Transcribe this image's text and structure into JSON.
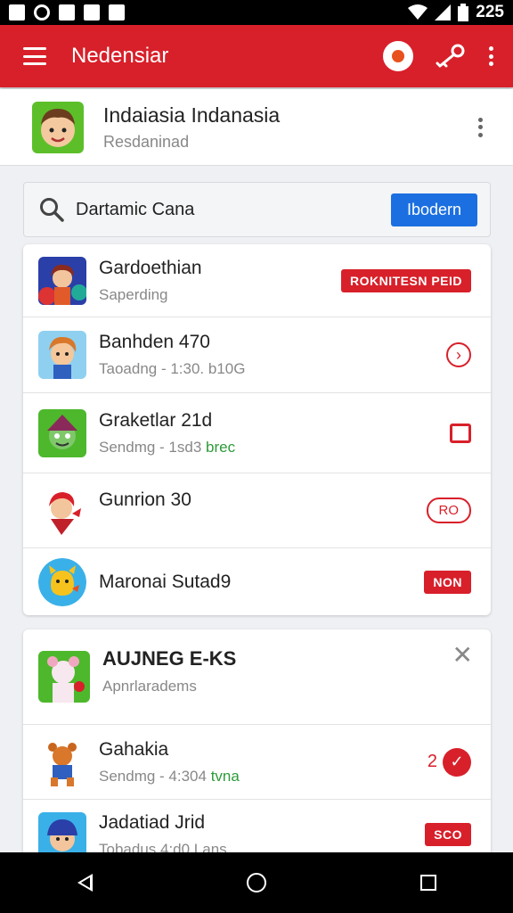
{
  "status_bar": {
    "time": "225"
  },
  "app_bar": {
    "title": "Nedensiar"
  },
  "profile": {
    "name": "Indaiasia Indanasia",
    "subtitle": "Resdaninad"
  },
  "search": {
    "value": "Dartamic Cana",
    "button_label": "Ibodern"
  },
  "list1": [
    {
      "title": "Gardoethian",
      "subtitle": "Saperding",
      "subtitle_extra": "",
      "action": "ROKNITESN PEID"
    },
    {
      "title": "Banhden 470",
      "subtitle": "Taoadng - 1:30. b10G",
      "subtitle_extra": "",
      "action": ""
    },
    {
      "title": "Graketlar 21d",
      "subtitle": "Sendmg - 1sd3",
      "subtitle_extra": "brec",
      "action": ""
    },
    {
      "title": "Gunrion 30",
      "subtitle": "",
      "subtitle_extra": "",
      "action": "RO"
    },
    {
      "title": "Maronai Sutad9",
      "subtitle": "",
      "subtitle_extra": "",
      "action": "NON"
    }
  ],
  "list2": [
    {
      "title": "AUJNEG E-KS",
      "subtitle": "Apnrlaradems",
      "subtitle_extra": "",
      "action": ""
    },
    {
      "title": "Gahakia",
      "subtitle": "Sendmg - 4:304",
      "subtitle_extra": "tvna",
      "action": "2"
    },
    {
      "title": "Jadatiad Jrid",
      "subtitle": "Tobadus 4:d0 Lans",
      "subtitle_extra": "",
      "action": "SCO"
    }
  ],
  "icons": {
    "menu": "hamburger-menu-icon",
    "badge": "notification-badge-icon",
    "key": "key-icon",
    "more": "more-vert-icon",
    "search": "search-icon",
    "close": "close-icon"
  },
  "colors": {
    "primary": "#d8202a",
    "accent": "#1b6fe0",
    "green": "#2e9a3a"
  }
}
